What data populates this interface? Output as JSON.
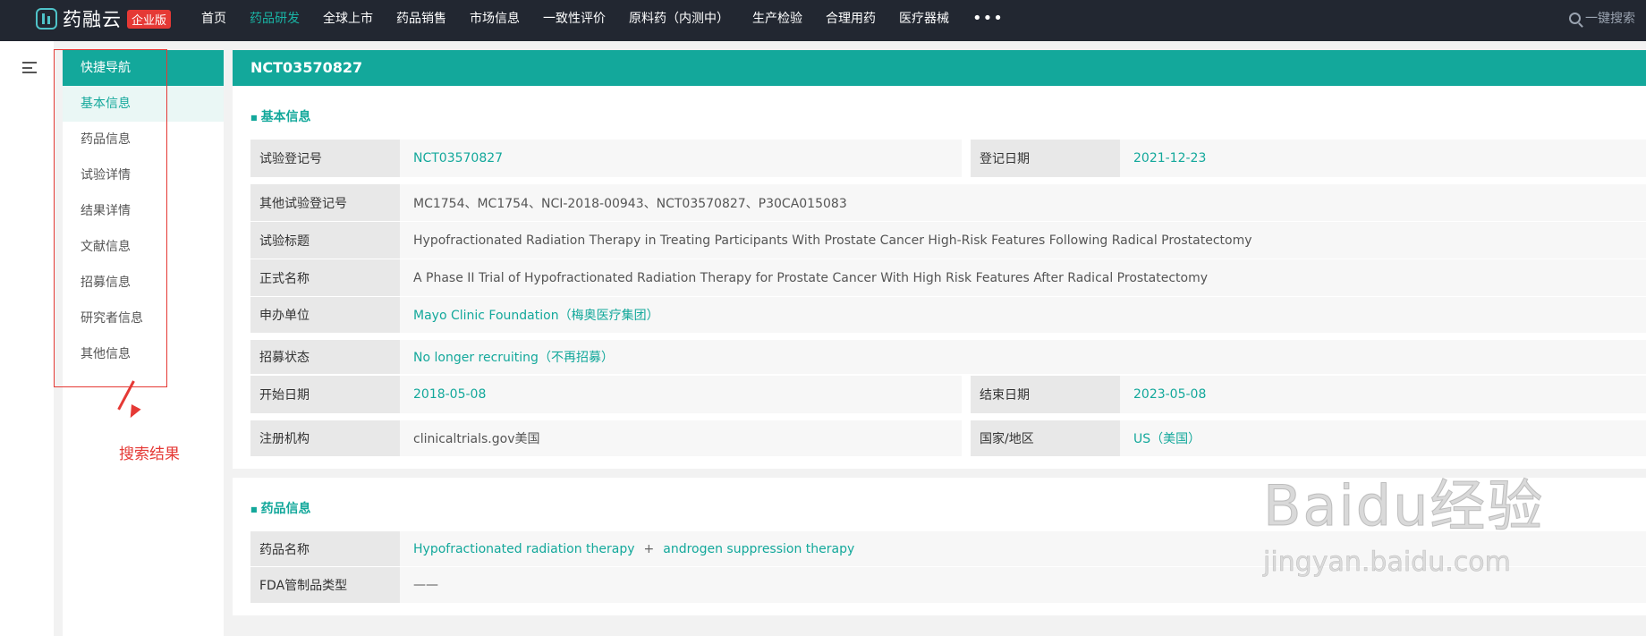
{
  "header": {
    "brand": "药融云",
    "edition_badge": "企业版",
    "nav": [
      "首页",
      "药品研发",
      "全球上市",
      "药品销售",
      "市场信息",
      "一致性评价",
      "原料药（内测中）",
      "生产检验",
      "合理用药",
      "医疗器械"
    ],
    "active_nav": "药品研发",
    "more_label": "•••",
    "search_label": "一键搜索"
  },
  "quicknav": {
    "title": "快捷导航",
    "items": [
      "基本信息",
      "药品信息",
      "试验详情",
      "结果详情",
      "文献信息",
      "招募信息",
      "研究者信息",
      "其他信息"
    ]
  },
  "annotation": {
    "label": "搜索结果",
    "color": "#e53935"
  },
  "page_title": "NCT03570827",
  "basic_info": {
    "title": "基本信息",
    "reg_no_label": "试验登记号",
    "reg_no": "NCT03570827",
    "reg_date_label": "登记日期",
    "reg_date": "2021-12-23",
    "other_reg_label": "其他试验登记号",
    "other_reg": "MC1754、MC1754、NCI-2018-00943、NCT03570827、P30CA015083",
    "trial_title_label": "试验标题",
    "trial_title": "Hypofractionated Radiation Therapy in Treating Participants With Prostate Cancer High-Risk Features Following Radical Prostatectomy",
    "official_name_label": "正式名称",
    "official_name": "A Phase II Trial of Hypofractionated Radiation Therapy for Prostate Cancer With High Risk Features After Radical Prostatectomy",
    "sponsor_label": "申办单位",
    "sponsor": "Mayo Clinic Foundation（梅奥医疗集团）",
    "recruit_status_label": "招募状态",
    "recruit_status": "No longer recruiting（不再招募）",
    "start_date_label": "开始日期",
    "start_date": "2018-05-08",
    "end_date_label": "结束日期",
    "end_date": "2023-05-08",
    "registry_label": "注册机构",
    "registry": "clinicaltrials.gov美国",
    "country_label": "国家/地区",
    "country": "US（美国）"
  },
  "drug_info": {
    "title": "药品信息",
    "drug_name_label": "药品名称",
    "drug_1": "Hypofractionated radiation therapy",
    "plus": "+",
    "drug_2": "androgen suppression therapy",
    "fda_label": "FDA管制品类型",
    "fda_value": "——"
  },
  "watermark": {
    "line1": "Baidu经验",
    "line2": "jingyan.baidu.com"
  },
  "colors": {
    "accent": "#13a89b",
    "topbar": "#222731",
    "badge": "#e53935"
  }
}
